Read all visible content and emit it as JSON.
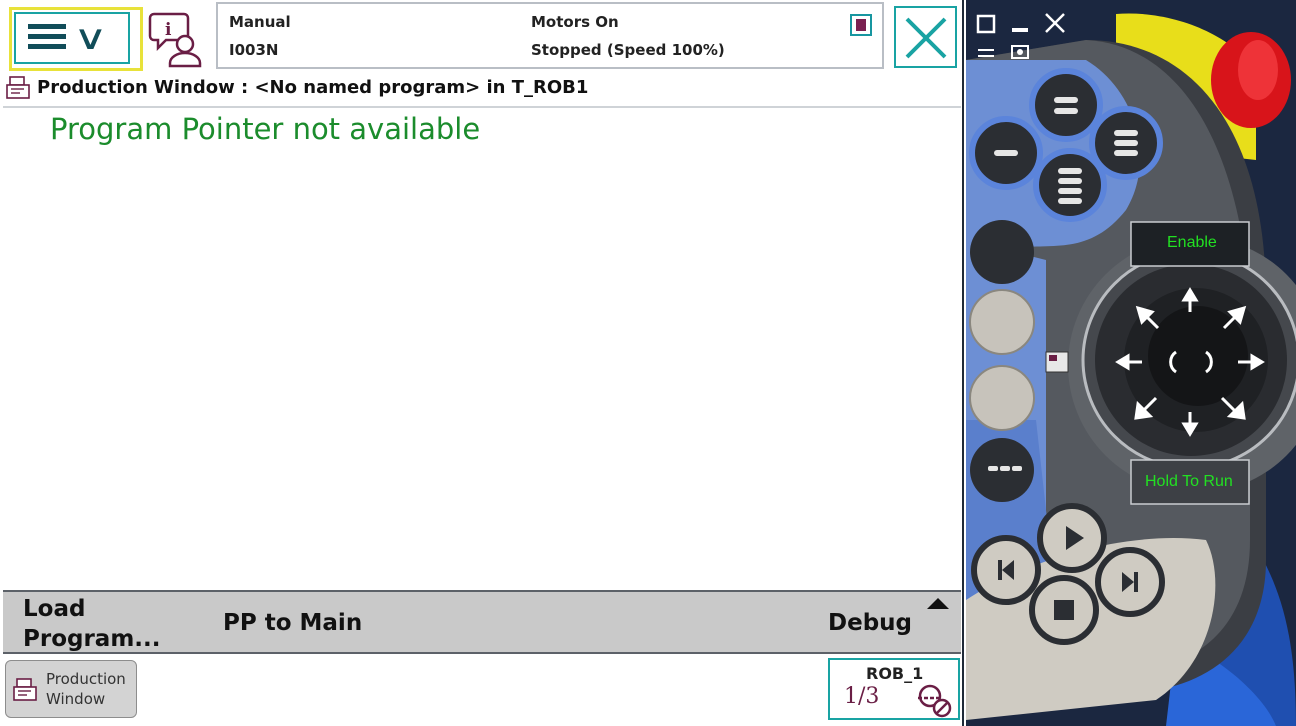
{
  "status": {
    "mode": "Manual",
    "system": "I003N",
    "motors": "Motors On",
    "state": "Stopped (Speed 100%)"
  },
  "window": {
    "title": "Production Window : <No named program> in T_ROB1",
    "message": "Program Pointer not available"
  },
  "commands": {
    "load_program_line1": "Load",
    "load_program_line2": "Program...",
    "pp_to_main": "PP to Main",
    "debug": "Debug"
  },
  "taskbar": {
    "production_window_line1": "Production",
    "production_window_line2": "Window",
    "robot_name": "ROB_1",
    "task_fraction": "1/3"
  },
  "device": {
    "enable_label": "Enable",
    "hold_to_run_label": "Hold To Run"
  },
  "colors": {
    "accent_teal": "#19a3a3",
    "highlight_yellow": "#e8e23a",
    "message_green": "#1b8c2c",
    "device_label_green": "#22e022"
  },
  "icons": {
    "menu": "hamburger-chevron-icon",
    "info": "info-user-icon",
    "close": "close-x-icon",
    "production": "production-window-icon",
    "robot_mode": "robot-mode-icon"
  }
}
